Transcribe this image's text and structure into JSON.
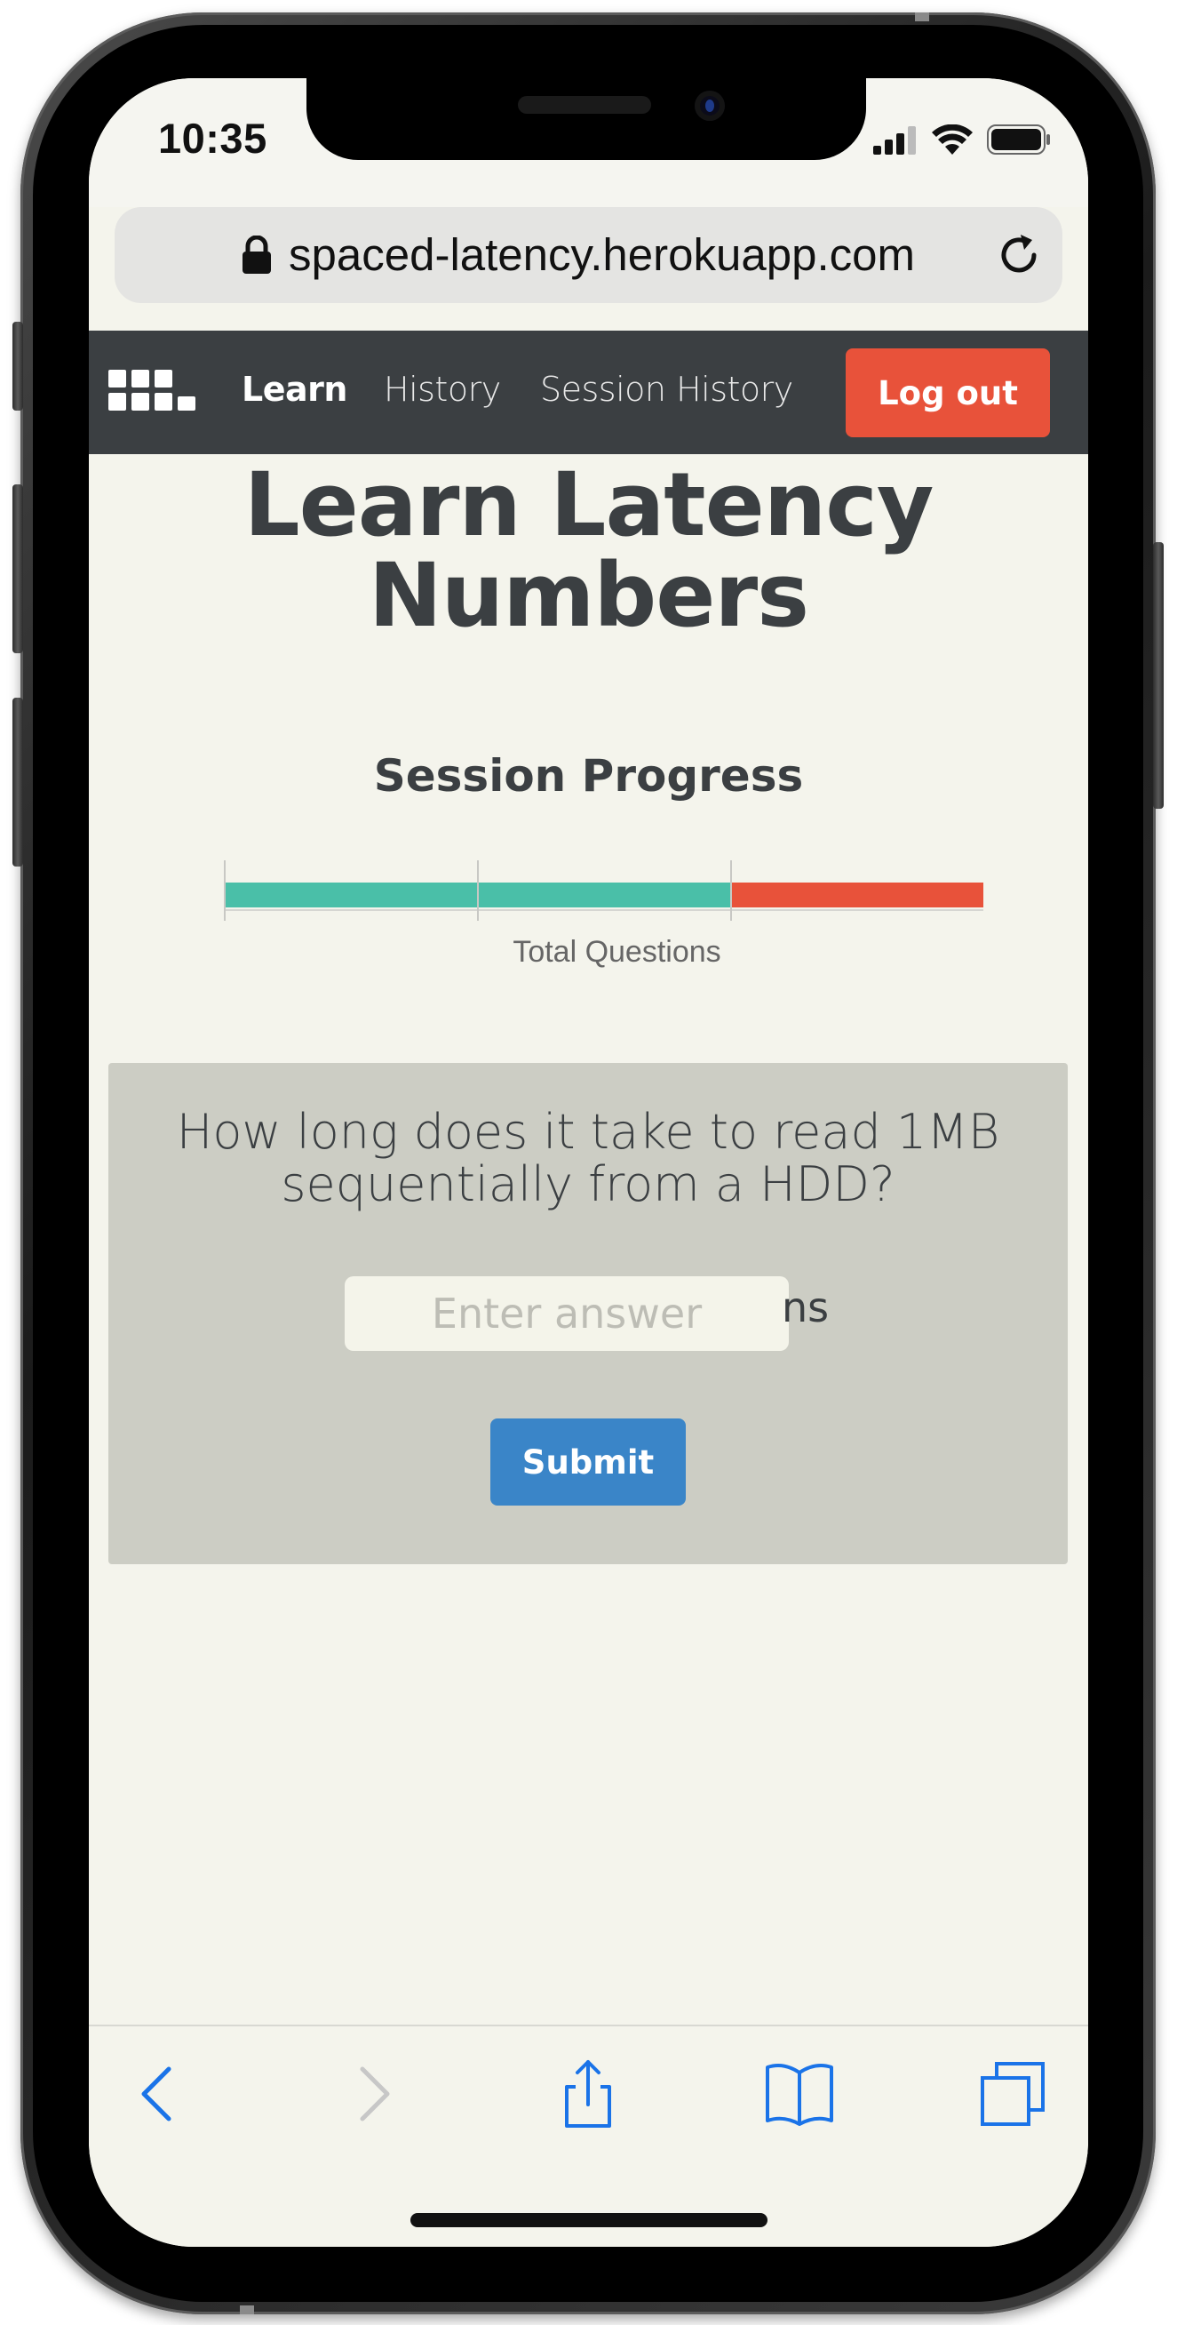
{
  "status_bar": {
    "time": "10:35"
  },
  "browser": {
    "url": "spaced-latency.herokuapp.com",
    "lock_icon": "lock-icon",
    "reload_icon": "reload-icon"
  },
  "navbar": {
    "logo_icon": "grid-logo-icon",
    "links": [
      {
        "label": "Learn",
        "active": true
      },
      {
        "label": "History",
        "active": false
      },
      {
        "label": "Session History",
        "active": false
      }
    ],
    "logout_label": "Log out"
  },
  "main": {
    "title": "Learn Latency Numbers",
    "progress": {
      "heading": "Session Progress",
      "axis_label": "Total Questions",
      "completed_fraction": 0.667,
      "colors": {
        "completed": "#4abfa8",
        "remaining": "#e8523a"
      }
    },
    "question": {
      "text": "How long does it take to read 1MB sequentially from a HDD?",
      "input_placeholder": "Enter answer",
      "input_value": "",
      "unit": "ns",
      "submit_label": "Submit"
    }
  },
  "toolbar": {
    "icons": [
      "back-icon",
      "forward-icon",
      "share-icon",
      "bookmarks-icon",
      "tabs-icon"
    ]
  },
  "colors": {
    "navbar_bg": "#3b3f42",
    "accent_red": "#e8523a",
    "accent_blue": "#3a85c8",
    "page_bg": "#f4f4ec",
    "card_bg": "#cccdc4",
    "ios_blue": "#1a73e8"
  }
}
